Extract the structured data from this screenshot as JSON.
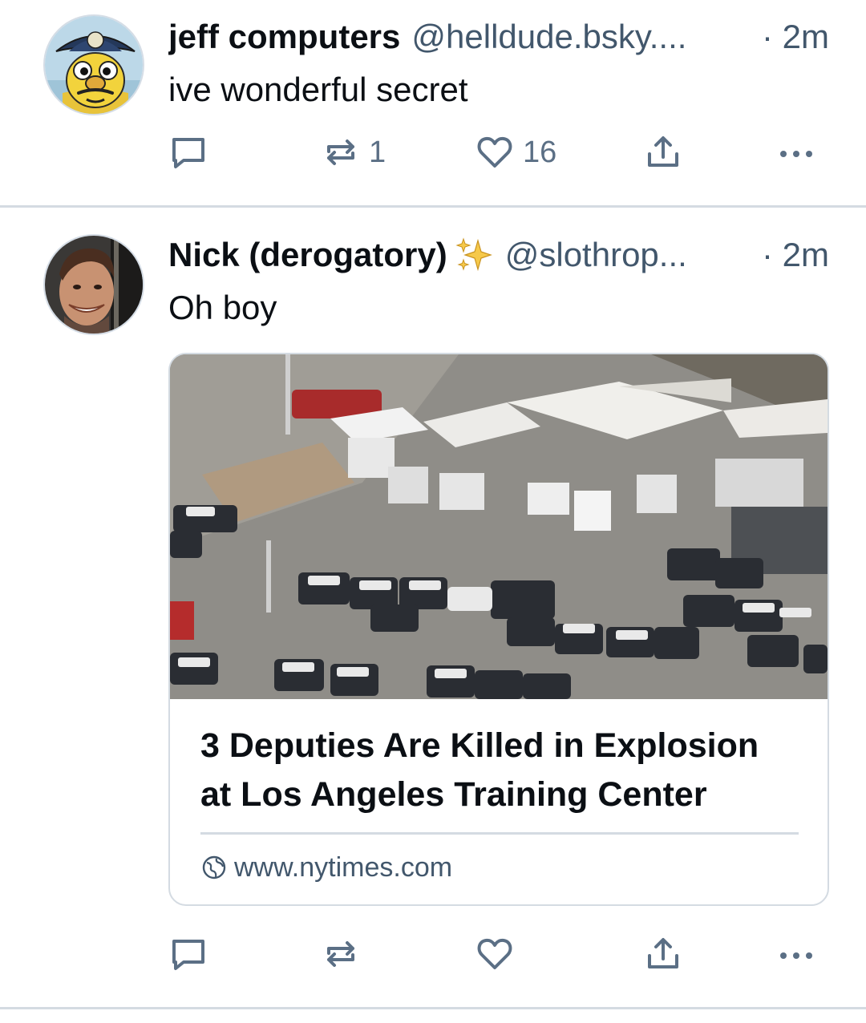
{
  "posts": [
    {
      "author_name": "jeff computers",
      "handle": "@helldude.bsky....",
      "separator": "·",
      "time": "2m",
      "text": "ive wonderful secret",
      "reposts": "1",
      "likes": "16"
    },
    {
      "author_name": "Nick (derogatory)",
      "name_emoji": "sparkles-icon",
      "handle": "@slothrop...",
      "separator": "·",
      "time": "2m",
      "text": "Oh boy",
      "reposts": "",
      "likes": "",
      "link_card": {
        "title": "3 Deputies Are Killed in Explosion at Los Angeles Training Center",
        "domain": "www.nytimes.com"
      }
    }
  ],
  "icons": {
    "reply": "speech-bubble-icon",
    "repost": "repost-arrows-icon",
    "like": "heart-icon",
    "share": "share-upload-icon",
    "more": "ellipsis-icon",
    "domain": "globe-icon"
  },
  "colors": {
    "text_primary": "#0b0f14",
    "text_secondary": "#42576c",
    "icon": "#5b6f85",
    "divider": "#d4dbe2",
    "background": "#ffffff"
  }
}
